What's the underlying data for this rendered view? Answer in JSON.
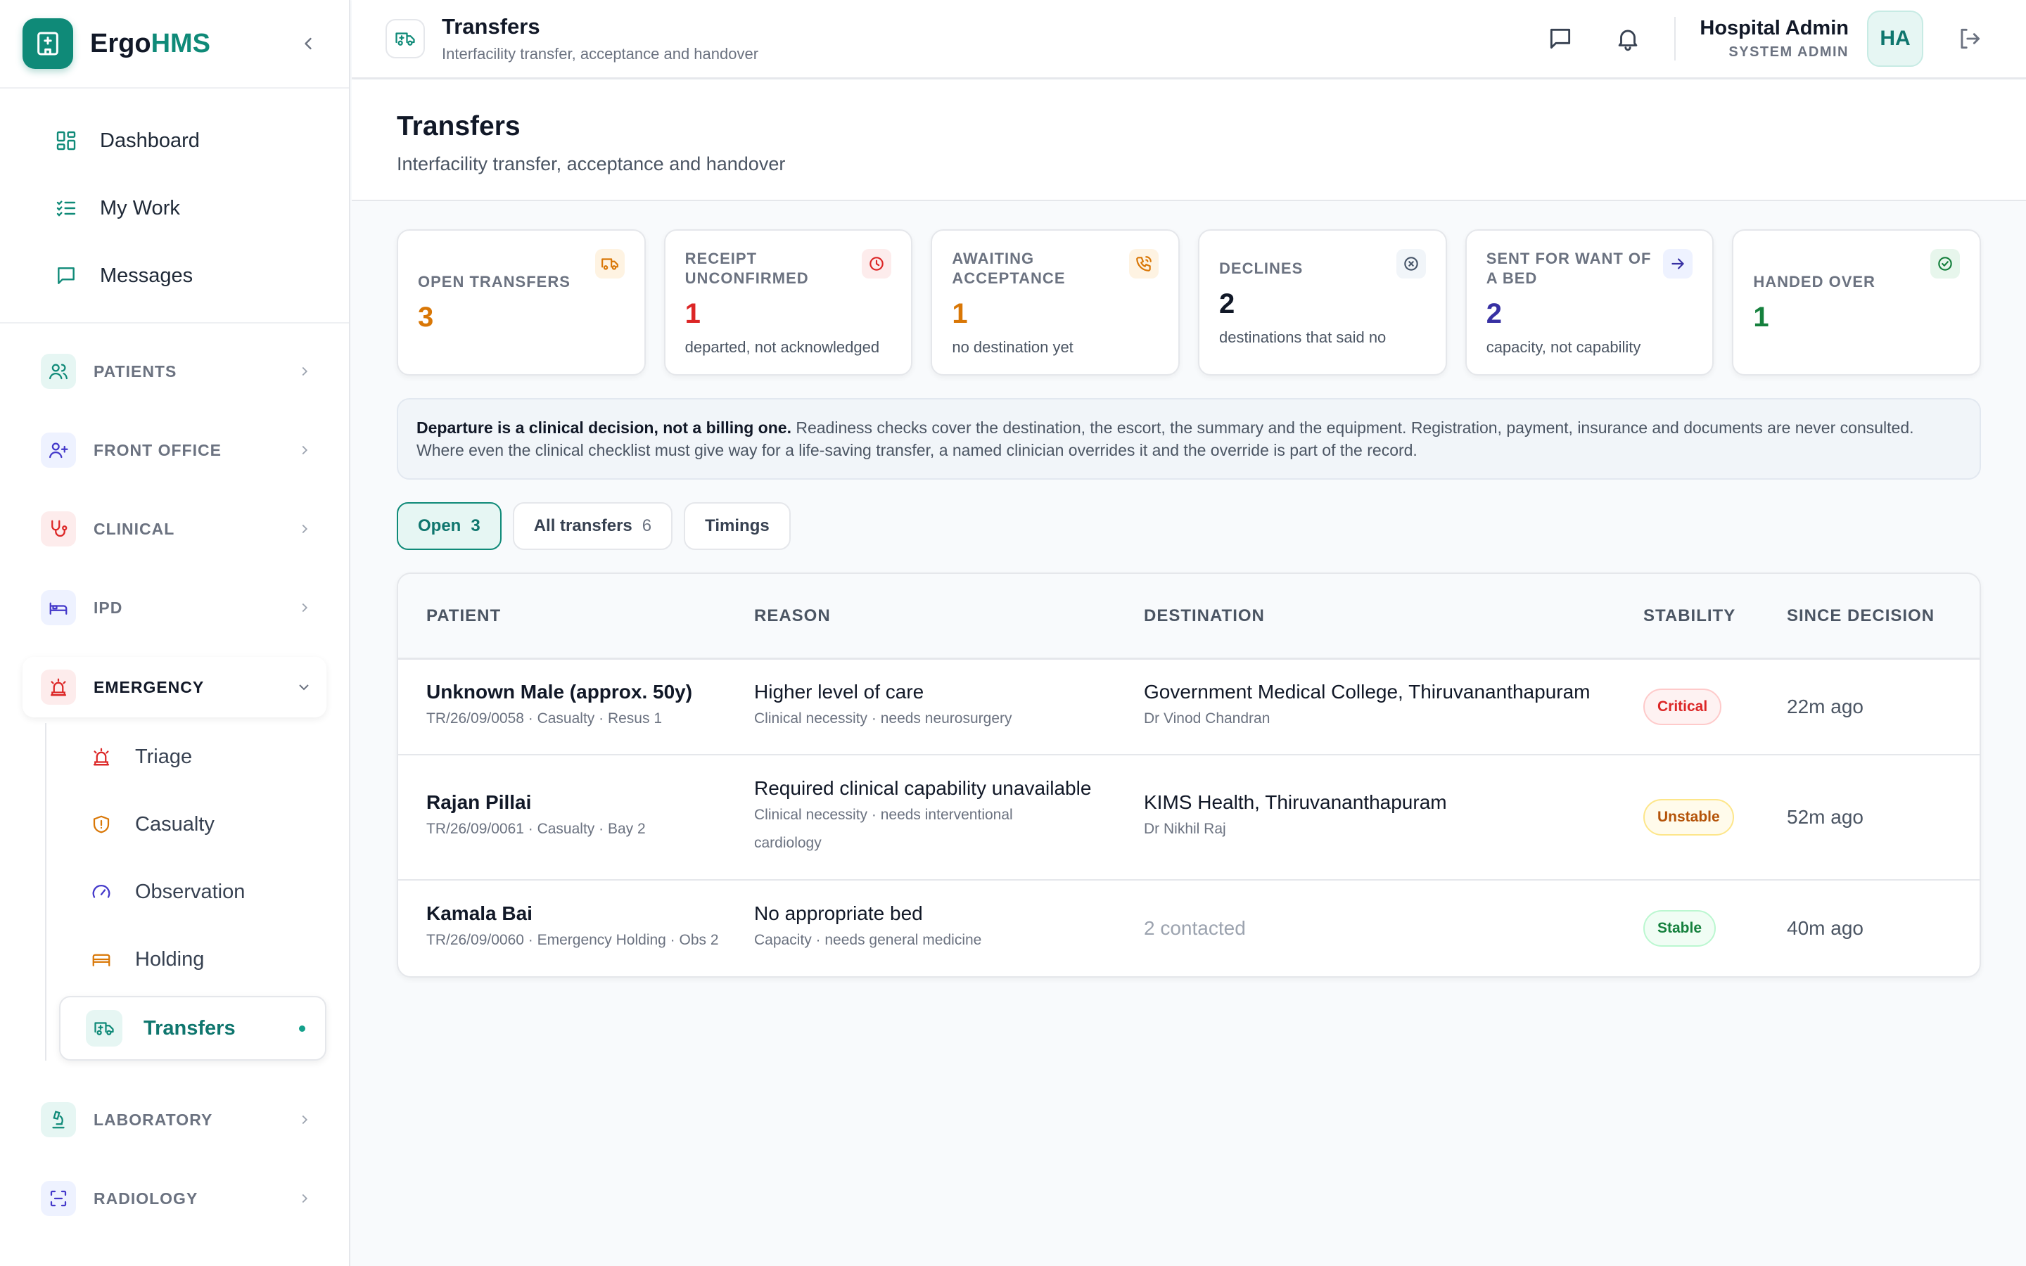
{
  "brand": {
    "prefix": "Ergo",
    "accent": "HMS",
    "color": "#0f8a78"
  },
  "nav": {
    "top": [
      {
        "label": "Dashboard",
        "icon": "grid-icon"
      },
      {
        "label": "My Work",
        "icon": "checklist-icon"
      },
      {
        "label": "Messages",
        "icon": "message-icon"
      }
    ],
    "sections": {
      "patients": "PATIENTS",
      "front_office": "FRONT OFFICE",
      "clinical": "CLINICAL",
      "ipd": "IPD",
      "emergency": "EMERGENCY",
      "laboratory": "LABORATORY",
      "radiology": "RADIOLOGY"
    },
    "emergency_items": [
      {
        "label": "Triage",
        "icon": "siren-icon"
      },
      {
        "label": "Casualty",
        "icon": "shield-icon"
      },
      {
        "label": "Observation",
        "icon": "gauge-icon"
      },
      {
        "label": "Holding",
        "icon": "bed-icon"
      },
      {
        "label": "Transfers",
        "icon": "ambulance-icon",
        "active": true
      }
    ]
  },
  "topbar": {
    "title": "Transfers",
    "subtitle": "Interfacility transfer, acceptance and handover",
    "user_name": "Hospital Admin",
    "user_role": "SYSTEM ADMIN",
    "avatar": "HA"
  },
  "page": {
    "title": "Transfers",
    "subtitle": "Interfacility transfer, acceptance and handover"
  },
  "stats": [
    {
      "label": "OPEN TRANSFERS",
      "value": "3",
      "note": "",
      "color": "#d97706",
      "icon": "ambulance-icon"
    },
    {
      "label": "RECEIPT UNCONFIRMED",
      "value": "1",
      "note": "departed, not acknowledged",
      "color": "#dc2626",
      "icon": "clock-icon"
    },
    {
      "label": "AWAITING ACCEPTANCE",
      "value": "1",
      "note": "no destination yet",
      "color": "#d97706",
      "icon": "phone-icon"
    },
    {
      "label": "DECLINES",
      "value": "2",
      "note": "destinations that said no",
      "color": "#111827",
      "icon": "x-circle-icon"
    },
    {
      "label": "SENT FOR WANT OF A BED",
      "value": "2",
      "note": "capacity, not capability",
      "color": "#3730a3",
      "icon": "arrow-right-icon"
    },
    {
      "label": "HANDED OVER",
      "value": "1",
      "note": "",
      "color": "#15803d",
      "icon": "check-circle-icon"
    }
  ],
  "notice": {
    "bold": "Departure is a clinical decision, not a billing one.",
    "text": " Readiness checks cover the destination, the escort, the summary and the equipment. Registration, payment, insurance and documents are never consulted. Where even the clinical checklist must give way for a life-saving transfer, a named clinician overrides it and the override is part of the record."
  },
  "tabs": [
    {
      "label": "Open",
      "count": "3",
      "active": true
    },
    {
      "label": "All transfers",
      "count": "6"
    },
    {
      "label": "Timings",
      "count": ""
    }
  ],
  "table": {
    "headers": [
      "PATIENT",
      "REASON",
      "DESTINATION",
      "STABILITY",
      "SINCE DECISION"
    ],
    "rows": [
      {
        "patient": "Unknown Male (approx. 50y)",
        "patient_sub": "TR/26/09/0058 · Casualty · Resus 1",
        "reason": "Higher level of care",
        "reason_sub": "Clinical necessity · needs neurosurgery",
        "destination": "Government Medical College, Thiruvananthapuram",
        "destination_sub": "Dr Vinod Chandran",
        "stability": "Critical",
        "since": "22m ago"
      },
      {
        "patient": "Rajan Pillai",
        "patient_sub": "TR/26/09/0061 · Casualty · Bay 2",
        "reason": "Required clinical capability unavailable",
        "reason_sub": "Clinical necessity · needs interventional cardiology",
        "destination": "KIMS Health, Thiruvananthapuram",
        "destination_sub": "Dr Nikhil Raj",
        "stability": "Unstable",
        "since": "52m ago"
      },
      {
        "patient": "Kamala Bai",
        "patient_sub": "TR/26/09/0060 · Emergency Holding · Obs 2",
        "reason": "No appropriate bed",
        "reason_sub": "Capacity · needs general medicine",
        "destination": "2 contacted",
        "destination_sub": "",
        "stability": "Stable",
        "since": "40m ago"
      }
    ]
  },
  "stability_colors": {
    "Critical": "#dc2626",
    "Unstable": "#b45309",
    "Stable": "#15803d"
  }
}
